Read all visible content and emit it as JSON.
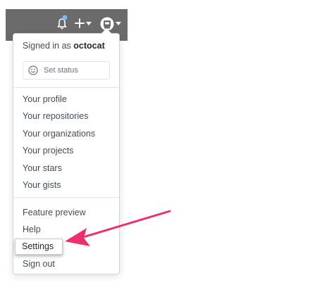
{
  "header": {
    "icons": [
      "bell-icon",
      "plus-icon",
      "avatar",
      "chevron-down-icon"
    ],
    "notification_dot_color": "#79b8ff"
  },
  "dropdown": {
    "signed_in_prefix": "Signed in as",
    "username": "octocat",
    "set_status_label": "Set status",
    "profile_items": [
      "Your profile",
      "Your repositories",
      "Your organizations",
      "Your projects",
      "Your stars",
      "Your gists"
    ],
    "account_items": [
      "Feature preview",
      "Help",
      "Settings",
      "Sign out"
    ]
  },
  "annotation": {
    "arrow_color": "#ee2e6e"
  }
}
